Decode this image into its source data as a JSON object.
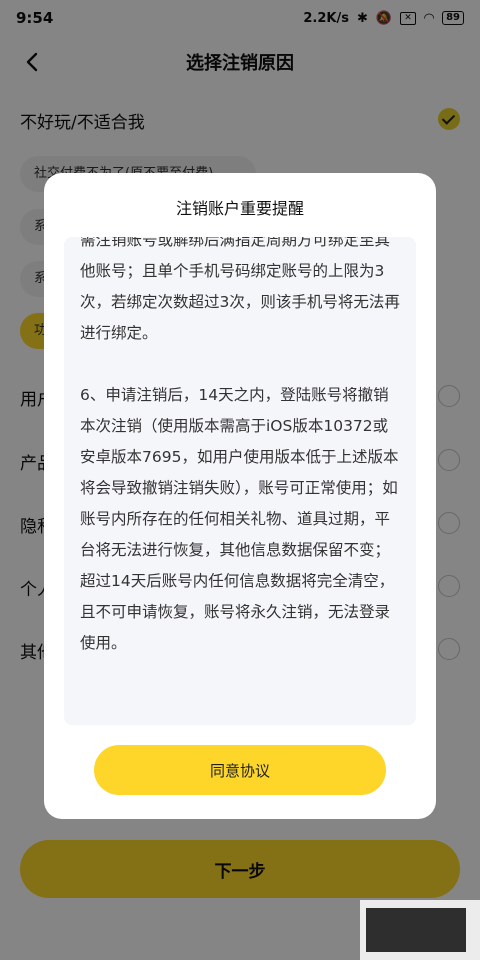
{
  "status": {
    "time": "9:54",
    "speed": "2.2K/s",
    "battery": "89"
  },
  "nav": {
    "title": "选择注销原因"
  },
  "reasons": {
    "r1": "不好玩/不适合我",
    "r2": "用户",
    "r3": "产品",
    "r4": "隐私",
    "r5": "个人",
    "r6": "其他"
  },
  "chips": {
    "c1": "社交付费不为了(原不要至付费)",
    "c2": "系",
    "c3": "系",
    "c4": "功"
  },
  "next_button": "下一步",
  "dialog": {
    "title": "注销账户重要提醒",
    "body": "需注销账号或解绑后满指定周期方可绑定至其他账号；且单个手机号码绑定账号的上限为3次，若绑定次数超过3次，则该手机号将无法再进行绑定。\n\n6、申请注销后，14天之内，登陆账号将撤销本次注销（使用版本需高于iOS版本10372或安卓版本7695，如用户使用版本低于上述版本将会导致撤销注销失败），账号可正常使用；如账号内所存在的任何相关礼物、道具过期，平台将无法进行恢复，其他信息数据保留不变；超过14天后账号内任何信息数据将完全清空，且不可申请恢复，账号将永久注销，无法登录使用。",
    "agree_button": "同意协议"
  },
  "colors": {
    "accent": "#fdd629",
    "overlay": "rgba(0,0,0,0.48)"
  }
}
